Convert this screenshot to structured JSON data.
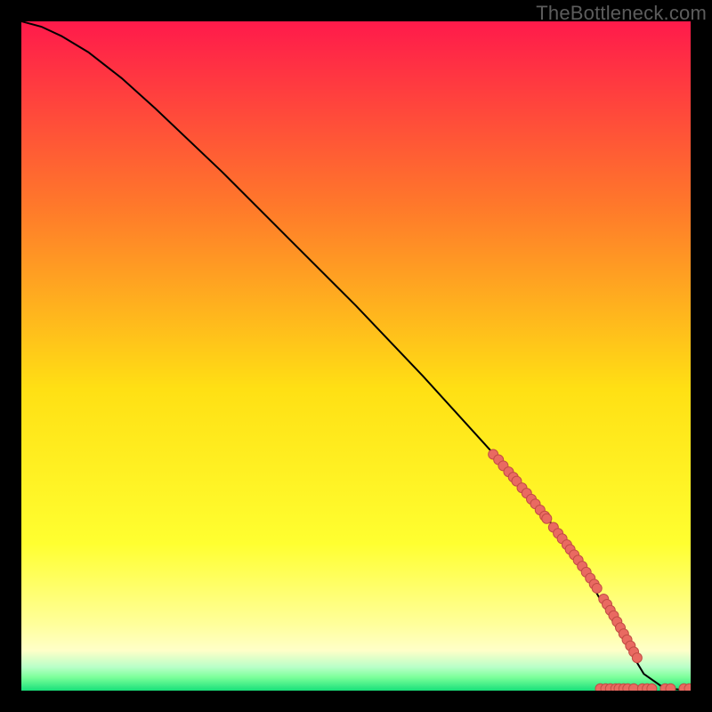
{
  "watermark": "TheBottleneck.com",
  "colors": {
    "top": "#ff1a4b",
    "upper_mid": "#ff8a2a",
    "mid": "#ffe014",
    "lower_yellow": "#ffff30",
    "pale": "#ffffc8",
    "green_light": "#7cff9a",
    "green": "#18e07a",
    "curve": "#000000",
    "marker_fill": "#e96a61",
    "marker_stroke": "#c24c44"
  },
  "chart_data": {
    "type": "line",
    "title": "",
    "xlabel": "",
    "ylabel": "",
    "xlim": [
      0,
      100
    ],
    "ylim": [
      0,
      100
    ],
    "curve": {
      "x": [
        0,
        3,
        6,
        10,
        15,
        20,
        30,
        40,
        50,
        60,
        70,
        80,
        83,
        86,
        90,
        93,
        96,
        100
      ],
      "y": [
        100,
        99.2,
        97.8,
        95.4,
        91.5,
        87.0,
        77.5,
        67.5,
        57.5,
        47.0,
        36.0,
        24.0,
        19.5,
        14.5,
        7.5,
        2.5,
        0.4,
        0.0
      ]
    },
    "series": [
      {
        "name": "segment-markers",
        "x": [
          70.5,
          71.3,
          72.0,
          72.8,
          73.5,
          74.0,
          74.8,
          75.5,
          76.2,
          76.8,
          77.5,
          78.2,
          78.5,
          79.5,
          80.2,
          80.8,
          81.5,
          82.0,
          82.6,
          83.2,
          83.8,
          84.4,
          85.0,
          85.6,
          86.0,
          87.0,
          87.5,
          88.0,
          88.5,
          89.0,
          89.5,
          90.0,
          90.5,
          91.0,
          91.5,
          92.0
        ],
        "y": [
          35.3,
          34.5,
          33.6,
          32.7,
          31.9,
          31.3,
          30.3,
          29.5,
          28.6,
          27.9,
          27.0,
          26.1,
          25.7,
          24.4,
          23.5,
          22.7,
          21.8,
          21.1,
          20.3,
          19.5,
          18.6,
          17.7,
          16.8,
          15.9,
          15.3,
          13.7,
          12.9,
          12.0,
          11.2,
          10.3,
          9.4,
          8.5,
          7.6,
          6.7,
          5.8,
          4.9
        ]
      },
      {
        "name": "floor-markers",
        "x": [
          86.5,
          87.3,
          88.0,
          88.8,
          89.3,
          90.0,
          90.6,
          91.5,
          92.8,
          93.5,
          94.2,
          96.2,
          97.0,
          99.0,
          99.8
        ],
        "y": [
          0.3,
          0.3,
          0.3,
          0.3,
          0.3,
          0.3,
          0.3,
          0.3,
          0.3,
          0.3,
          0.3,
          0.3,
          0.3,
          0.3,
          0.3
        ]
      }
    ]
  }
}
